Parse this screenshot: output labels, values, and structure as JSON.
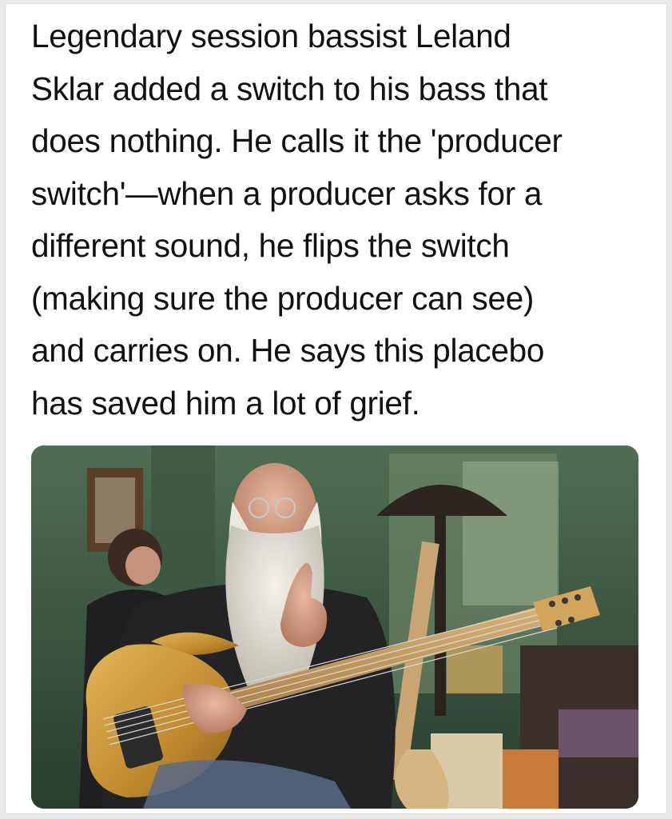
{
  "post": {
    "lines": [
      "Legendary session bassist Leland",
      "Sklar added a switch to his bass that",
      "does nothing. He calls it the 'producer",
      "switch'—when a producer asks for a",
      "different sound, he flips the switch",
      "(making sure the producer can see)",
      "and carries on. He says this placebo",
      "has saved him a lot of grief."
    ]
  },
  "photo": {
    "subject": "bearded bassist with bass guitar giving thumbs up",
    "colors": {
      "wall": "#3d5a45",
      "bass_body": "#c8973a",
      "beard": "#e8e4dc"
    }
  }
}
